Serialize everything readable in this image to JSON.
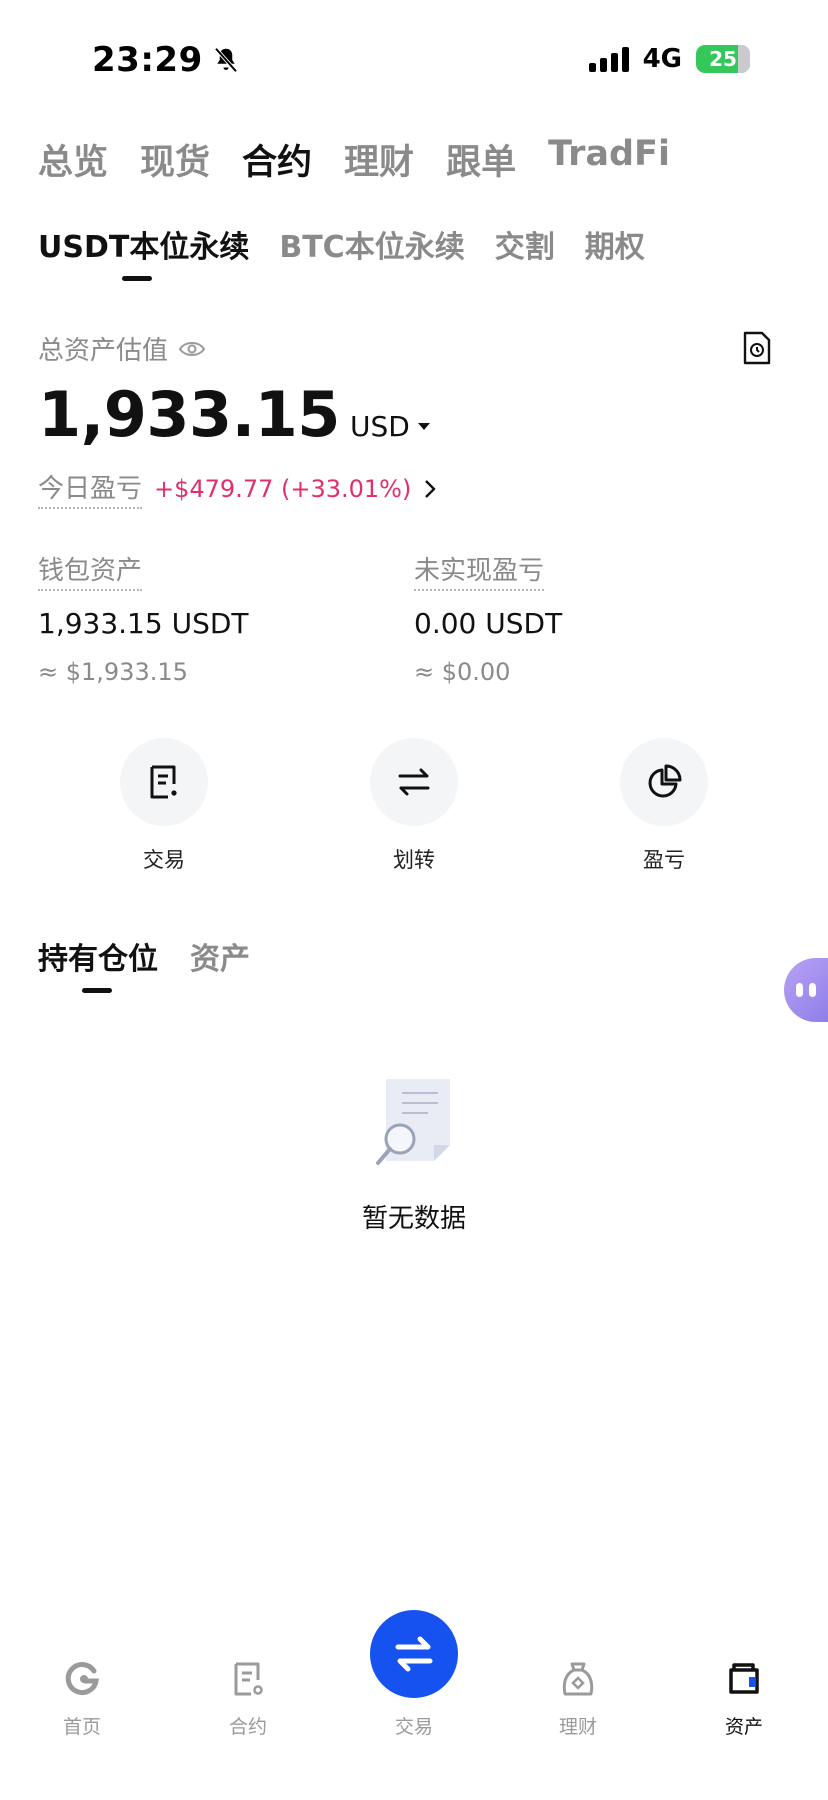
{
  "status_bar": {
    "time": "23:29",
    "network": "4G",
    "battery": "25"
  },
  "top_tabs": [
    {
      "label": "总览"
    },
    {
      "label": "现货"
    },
    {
      "label": "合约"
    },
    {
      "label": "理财"
    },
    {
      "label": "跟单"
    },
    {
      "label": "TradFi"
    }
  ],
  "sub_tabs": [
    {
      "label": "USDT本位永续"
    },
    {
      "label": "BTC本位永续"
    },
    {
      "label": "交割"
    },
    {
      "label": "期权"
    }
  ],
  "overview": {
    "total_label": "总资产估值",
    "total_amount": "1,933.15",
    "currency": "USD",
    "today_pnl_label": "今日盈亏",
    "today_pnl_value": "+$479.77 (+33.01%)"
  },
  "stats": {
    "wallet": {
      "label": "钱包资产",
      "value": "1,933.15 USDT",
      "approx": "≈ $1,933.15"
    },
    "unrealized": {
      "label": "未实现盈亏",
      "value": "0.00 USDT",
      "approx": "≈ $0.00"
    }
  },
  "actions": {
    "trade": "交易",
    "transfer": "划转",
    "pnl": "盈亏"
  },
  "position_tabs": {
    "positions": "持有仓位",
    "assets": "资产"
  },
  "empty_state": {
    "text": "暂无数据"
  },
  "bottom_nav": {
    "home": "首页",
    "futures": "合约",
    "trade": "交易",
    "earn": "理财",
    "assets": "资产"
  },
  "colors": {
    "accent_blue": "#1652f0",
    "pnl_positive": "#e0306a",
    "battery_green": "#34c759"
  }
}
